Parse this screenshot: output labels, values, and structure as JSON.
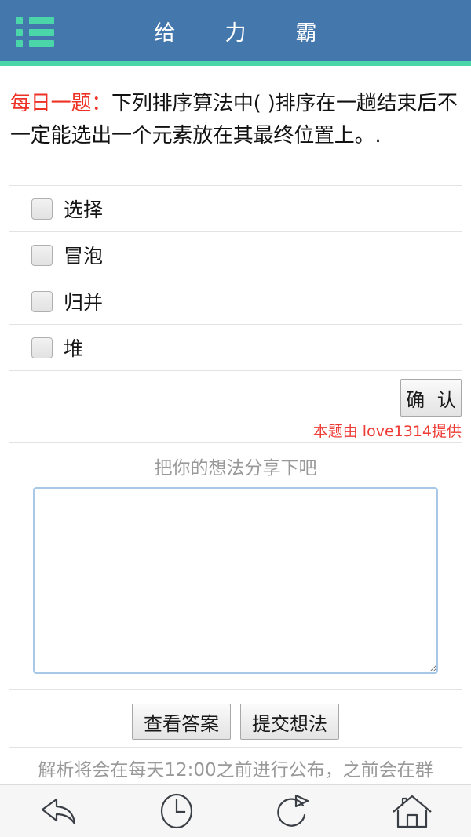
{
  "header": {
    "title": "给　力　霸",
    "menu_icon": "list-menu-icon",
    "background_color": "#4478ad",
    "accent_color": "#4ad6a8"
  },
  "question": {
    "tag": "每日一题：",
    "text": "下列排序算法中( )排序在一趟结束后不一定能选出一个元素放在其最终位置上。.",
    "tag_color": "#ee3124"
  },
  "options": [
    {
      "label": "选择",
      "checked": false
    },
    {
      "label": "冒泡",
      "checked": false
    },
    {
      "label": "归并",
      "checked": false
    },
    {
      "label": "堆",
      "checked": false
    }
  ],
  "confirm": {
    "label": "确 认",
    "provider_note": "本题由 love1314提供",
    "provider_color": "#ee3b36"
  },
  "share": {
    "label": "把你的想法分享下吧",
    "textarea_value": "",
    "textarea_placeholder": ""
  },
  "actions": {
    "view_answer_label": "查看答案",
    "submit_thought_label": "提交想法"
  },
  "footer": {
    "note": "解析将会在每天12:00之前进行公布，之前会在群"
  },
  "navbar": {
    "items": [
      {
        "icon": "back-arrow-icon",
        "label": ""
      },
      {
        "icon": "clock-icon",
        "label": ""
      },
      {
        "icon": "refresh-forward-icon",
        "label": ""
      },
      {
        "icon": "home-icon",
        "label": ""
      }
    ]
  }
}
